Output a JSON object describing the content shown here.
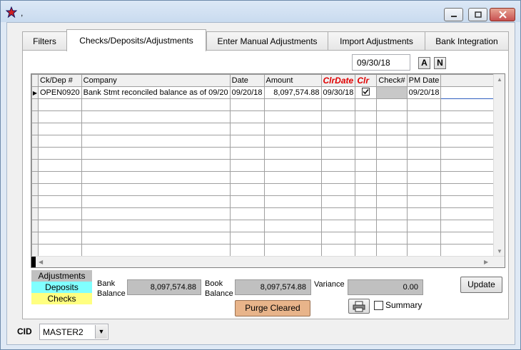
{
  "window": {
    "title": ",",
    "minimize_icon": "minimize-icon",
    "maximize_icon": "maximize-icon",
    "close_icon": "close-icon"
  },
  "tabs": [
    {
      "label": "Filters",
      "active": false
    },
    {
      "label": "Checks/Deposits/Adjustments",
      "active": true
    },
    {
      "label": "Enter Manual Adjustments",
      "active": false
    },
    {
      "label": "Import Adjustments",
      "active": false
    },
    {
      "label": "Bank Integration",
      "active": false
    }
  ],
  "date_filter": {
    "value": "09/30/18"
  },
  "buttons": {
    "a_label": "A",
    "n_label": "N",
    "update_label": "Update",
    "purge_label": "Purge Cleared",
    "print_icon": "printer-icon"
  },
  "grid": {
    "columns": [
      "Ck/Dep #",
      "Company",
      "Date",
      "Amount",
      "ClrDate",
      "Clr",
      "Check#",
      "PM Date"
    ],
    "rows": [
      {
        "ck_dep": "OPEN0920",
        "company": "Bank Stmt reconciled balance as of 09/20",
        "date": "09/20/18",
        "amount": "8,097,574.88",
        "clr_date": "09/30/18",
        "clr": true,
        "check_no": "",
        "pm_date": "09/20/18"
      }
    ]
  },
  "legend": {
    "adjustments": "Adjustments",
    "deposits": "Deposits",
    "checks": "Checks",
    "colors": {
      "adjustments": "#c0c0c0",
      "deposits": "#80ffff",
      "checks": "#ffff80"
    }
  },
  "balances": {
    "bank_label_1": "Bank",
    "bank_label_2": "Balance",
    "bank_value": "8,097,574.88",
    "book_label_1": "Book",
    "book_label_2": "Balance",
    "book_value": "8,097,574.88",
    "variance_label": "Variance",
    "variance_value": "0.00"
  },
  "summary": {
    "label": "Summary",
    "checked": false
  },
  "cid": {
    "label": "CID",
    "value": "MASTER2"
  }
}
